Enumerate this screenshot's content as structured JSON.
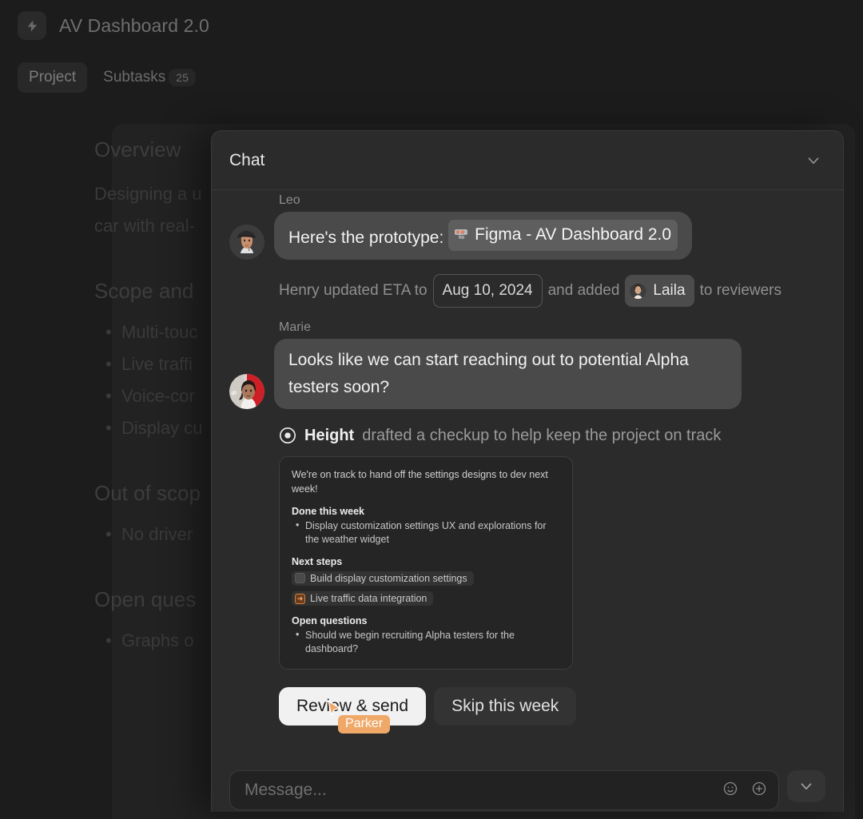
{
  "background": {
    "logo_icon": "lightning-bolt-icon",
    "title": "AV Dashboard 2.0",
    "tabs": [
      {
        "label": "Project",
        "active": true
      },
      {
        "label": "Subtasks",
        "active": false,
        "count": "25"
      }
    ],
    "sections": {
      "overview_heading": "Overview",
      "overview_line1": "Designing a u",
      "overview_line2": "car with real-",
      "scope_heading": "Scope and",
      "scope_items": [
        "Multi-touc",
        "Live traffi",
        "Voice-cor",
        "Display cu"
      ],
      "out_of_scope_heading": "Out of scop",
      "out_of_scope_items": [
        "No driver"
      ],
      "open_questions_heading": "Open ques",
      "open_questions_items": [
        "Graphs o"
      ]
    }
  },
  "chat": {
    "header_title": "Chat",
    "collapse_icon": "chevron-down-icon",
    "messages": [
      {
        "sender": "Leo",
        "avatar": "leo-avatar",
        "text_before": "Here's the prototype:",
        "link_icon": "figma-favicon",
        "link_text": "Figma - AV Dashboard 2.0"
      }
    ],
    "system_event": {
      "actor": "Henry",
      "text_1": "Henry updated ETA to",
      "date_pill": "Aug 10, 2024",
      "text_2": "and added",
      "person_pill": "Laila",
      "person_avatar": "laila-avatar",
      "text_3": "to reviewers"
    },
    "marie_message": {
      "sender": "Marie",
      "avatar": "marie-avatar",
      "text": "Looks like we can start reaching out to potential Alpha testers soon?"
    },
    "checkup": {
      "icon": "target-icon",
      "app_name": "Height",
      "description": "drafted a checkup to help keep the project on track",
      "card": {
        "lead": "We're on track to hand off the settings designs to dev next week!",
        "done_heading": "Done this week",
        "done_items": [
          "Display customization settings UX and explorations for the weather widget"
        ],
        "next_heading": "Next steps",
        "next_tasks": [
          {
            "label": "Build display customization settings",
            "icon": "grey-square-icon"
          },
          {
            "label": "Live traffic data integration",
            "icon": "orange-arrow-square-icon"
          }
        ],
        "open_heading": "Open questions",
        "open_items": [
          "Should we begin recruiting Alpha testers for the dashboard?"
        ]
      },
      "primary_button": "Review & send",
      "secondary_button": "Skip this week"
    },
    "remote_cursor": {
      "label": "Parker",
      "color": "#f0a868"
    },
    "composer": {
      "placeholder": "Message...",
      "emoji_icon": "emoji-smiley-icon",
      "attach_icon": "plus-circle-icon",
      "collapse_icon": "chevron-down-icon"
    }
  },
  "colors": {
    "page_bg": "#1c1c1c",
    "panel_bg": "#2b2b2b",
    "bubble": "#4a4a4a",
    "primary_button": "#f1f1f1",
    "cursor": "#f0a868",
    "accent_orange": "#d9813b"
  }
}
